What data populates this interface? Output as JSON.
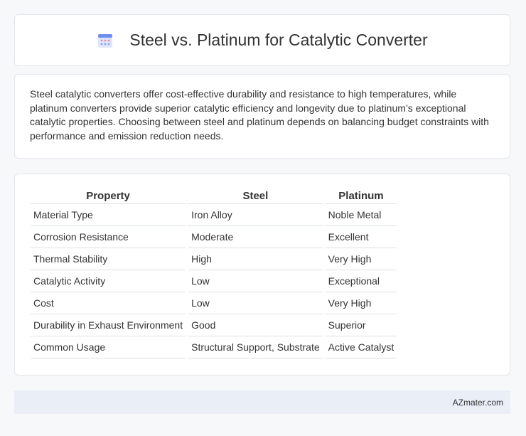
{
  "header": {
    "title": "Steel vs. Platinum for Catalytic Converter",
    "icon": "calendar-icon"
  },
  "summary": {
    "text": "Steel catalytic converters offer cost-effective durability and resistance to high temperatures, while platinum converters provide superior catalytic efficiency and longevity due to platinum’s exceptional catalytic properties. Choosing between steel and platinum depends on balancing budget constraints with performance and emission reduction needs."
  },
  "table": {
    "headers": [
      "Property",
      "Steel",
      "Platinum"
    ],
    "rows": [
      [
        "Material Type",
        "Iron Alloy",
        "Noble Metal"
      ],
      [
        "Corrosion Resistance",
        "Moderate",
        "Excellent"
      ],
      [
        "Thermal Stability",
        "High",
        "Very High"
      ],
      [
        "Catalytic Activity",
        "Low",
        "Exceptional"
      ],
      [
        "Cost",
        "Low",
        "Very High"
      ],
      [
        "Durability in Exhaust Environment",
        "Good",
        "Superior"
      ],
      [
        "Common Usage",
        "Structural Support, Substrate",
        "Active Catalyst"
      ]
    ]
  },
  "footer": {
    "brand": "AZmater.com"
  },
  "colors": {
    "background": "#f7f8fa",
    "card": "#ffffff",
    "footer": "#e9eef7",
    "icon_blue": "#6c8ff0",
    "icon_pink": "#e68aa8"
  }
}
